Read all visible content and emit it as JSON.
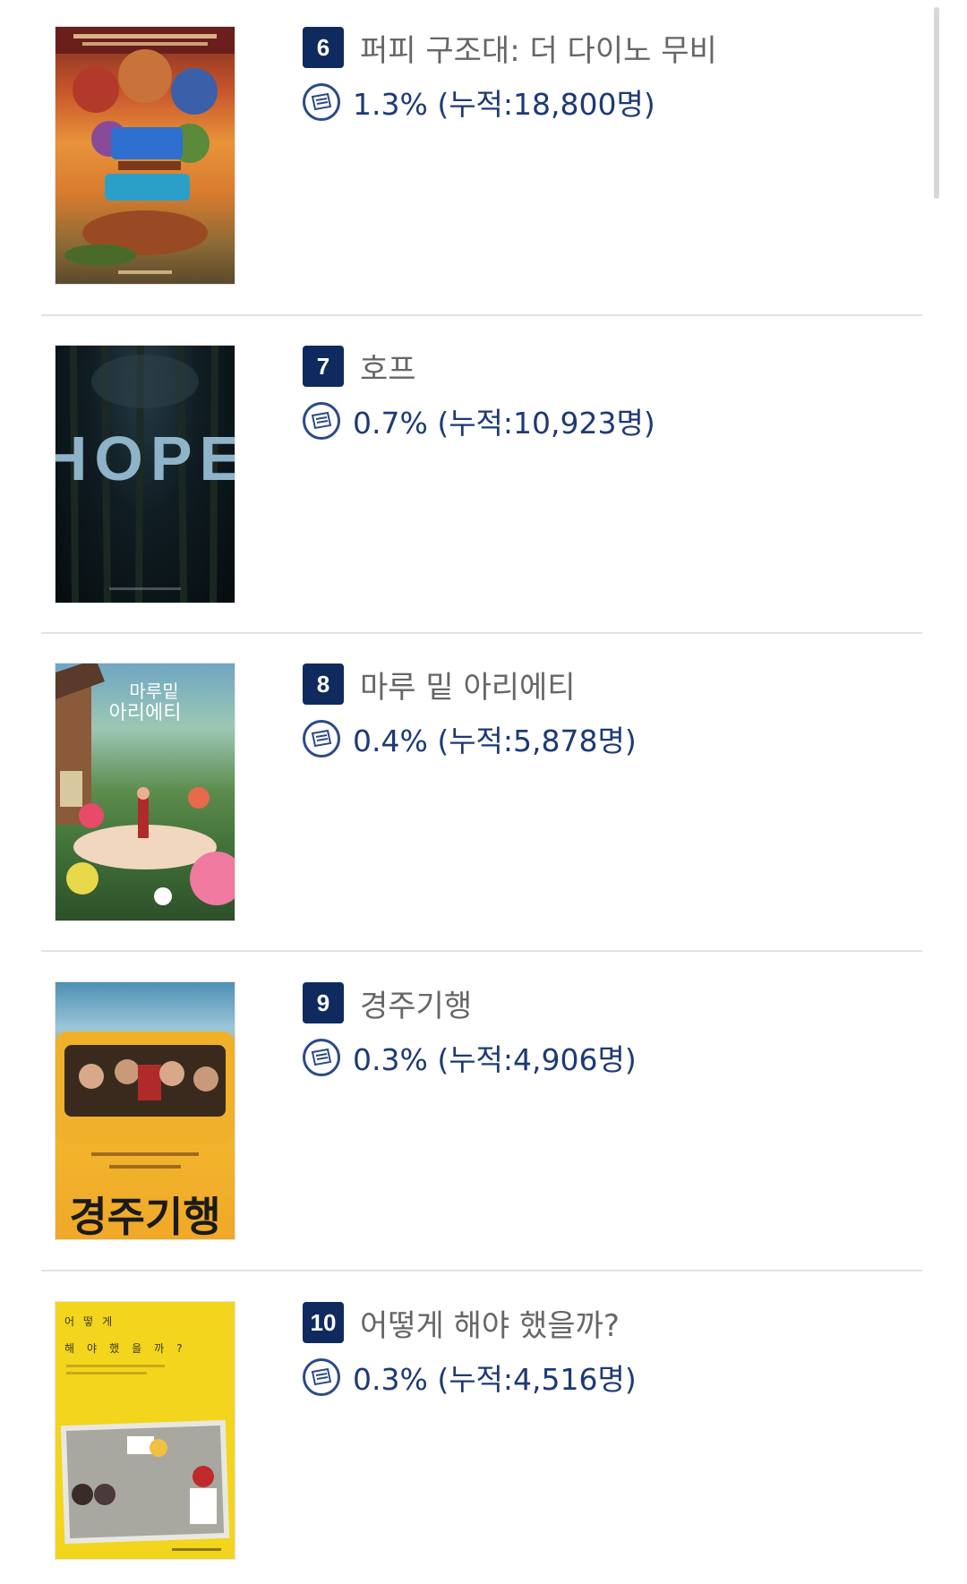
{
  "movies": [
    {
      "rank": "6",
      "title": "퍼피 구조대: 더 다이노 무비",
      "stat": "1.3% (누적:18,800명)",
      "poster_alt": "퍼피 구조대 더 다이노 무비 poster"
    },
    {
      "rank": "7",
      "title": "호프",
      "stat": "0.7% (누적:10,923명)",
      "poster_alt": "호프 poster",
      "poster_word": "HOPE"
    },
    {
      "rank": "8",
      "title": "마루 밑 아리에티",
      "stat": "0.4% (누적:5,878명)",
      "poster_alt": "마루 밑 아리에티 poster",
      "poster_word": "마루밑\n아리에티"
    },
    {
      "rank": "9",
      "title": "경주기행",
      "stat": "0.3% (누적:4,906명)",
      "poster_alt": "경주기행 poster",
      "poster_word": "경주기행"
    },
    {
      "rank": "10",
      "title": "어떻게 해야 했을까?",
      "stat": "0.3% (누적:4,516명)",
      "poster_alt": "어떻게 해야 했을까? poster",
      "poster_word": "어 떻 게\n해 야 했 을 까 ?"
    }
  ],
  "colors": {
    "rank_badge": "#0f2a5e",
    "stat_text": "#1d3a75",
    "title_text": "#666666",
    "divider": "#e2e2e2"
  },
  "icons": {
    "stat_icon": "ticket-icon"
  }
}
